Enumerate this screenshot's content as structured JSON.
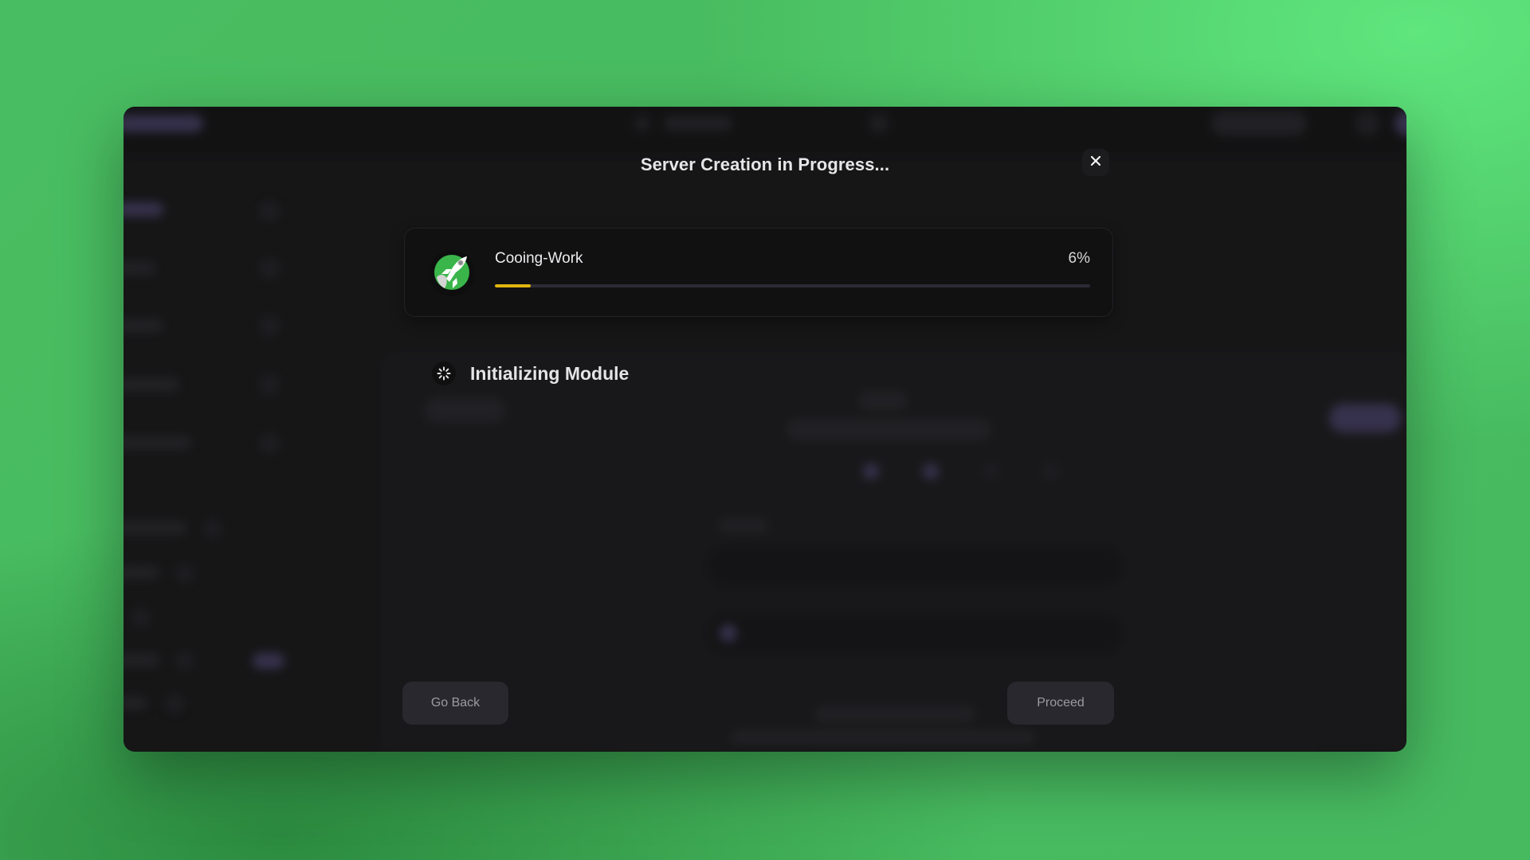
{
  "modal": {
    "title": "Server Creation in Progress...",
    "close_label": "×",
    "server": {
      "name": "Cooing-Work",
      "progress_percent": 6,
      "progress_label": "6%",
      "icon": "rocket-icon"
    },
    "status": {
      "icon": "spinner-icon",
      "text": "Initializing Module"
    },
    "buttons": {
      "back_label": "Go Back",
      "proceed_label": "Proceed"
    }
  },
  "colors": {
    "progress_fill": "#e0b40f",
    "progress_track": "#2c2b35",
    "window_bg": "#161617",
    "accent_purple": "#3a3452",
    "background_green": "#49bd61"
  }
}
